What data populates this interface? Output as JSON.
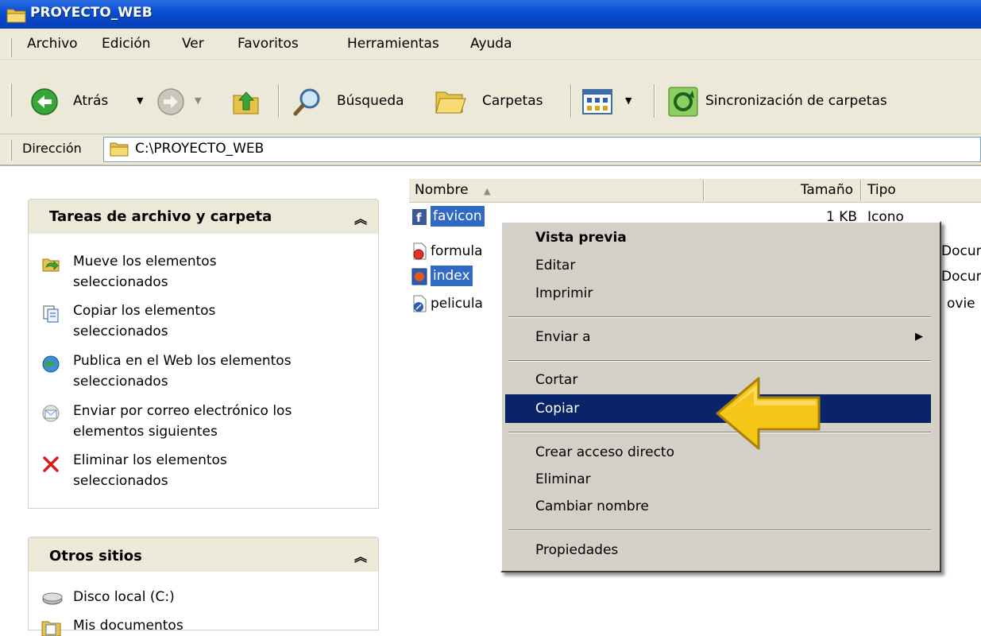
{
  "window": {
    "title": "PROYECTO_WEB"
  },
  "menu": [
    "Archivo",
    "Edición",
    "Ver",
    "Favoritos",
    "Herramientas",
    "Ayuda"
  ],
  "toolbar": {
    "back_label": "Atrás",
    "search_label": "Búsqueda",
    "folders_label": "Carpetas",
    "sync_label": "Sincronización de carpetas"
  },
  "address": {
    "label": "Dirección",
    "value": "C:\\PROYECTO_WEB"
  },
  "left_pane": {
    "tasks": {
      "title": "Tareas de archivo y carpeta",
      "items": [
        {
          "icon": "move-icon",
          "line1": "Mueve los elementos",
          "line2": "seleccionados"
        },
        {
          "icon": "copy-icon",
          "line1": "Copiar los elementos",
          "line2": "seleccionados"
        },
        {
          "icon": "publish-web-icon",
          "line1": "Publica en el Web los elementos",
          "line2": "seleccionados"
        },
        {
          "icon": "email-icon",
          "line1": "Enviar por correo electrónico los",
          "line2": "elementos siguientes"
        },
        {
          "icon": "delete-icon",
          "line1": "Eliminar los elementos",
          "line2": "seleccionados"
        }
      ]
    },
    "other_places": {
      "title": "Otros sitios",
      "items": [
        {
          "icon": "disk-icon",
          "label": "Disco local (C:)"
        },
        {
          "icon": "documents-icon",
          "label": "Mis documentos"
        }
      ]
    }
  },
  "file_list": {
    "columns": {
      "name": "Nombre",
      "size": "Tamaño",
      "type": "Tipo"
    },
    "rows": [
      {
        "name": "favicon",
        "size": "1 KB",
        "type": "Icono",
        "selected": true
      },
      {
        "name": "formula",
        "size": "",
        "type": "Docume",
        "selected": false
      },
      {
        "name": "index",
        "size": "",
        "type": "Docum",
        "selected": true
      },
      {
        "name": "pelicula",
        "size": "",
        "type": "ovie",
        "selected": false
      }
    ]
  },
  "context_menu": {
    "items": [
      {
        "label": "Vista previa",
        "bold": true
      },
      {
        "label": "Editar"
      },
      {
        "label": "Imprimir"
      },
      {
        "label": "Enviar a",
        "submenu": true
      },
      {
        "label": "Cortar"
      },
      {
        "label": "Copiar",
        "highlighted": true
      },
      {
        "label": "Crear acceso directo"
      },
      {
        "label": "Eliminar"
      },
      {
        "label": "Cambiar nombre"
      },
      {
        "label": "Propiedades"
      }
    ]
  },
  "colors": {
    "titlebar_blue": "#0a4fd2",
    "menu_highlight": "#0a246a",
    "arrow_yellow": "#f5c518",
    "selection_blue": "#316ac5"
  }
}
